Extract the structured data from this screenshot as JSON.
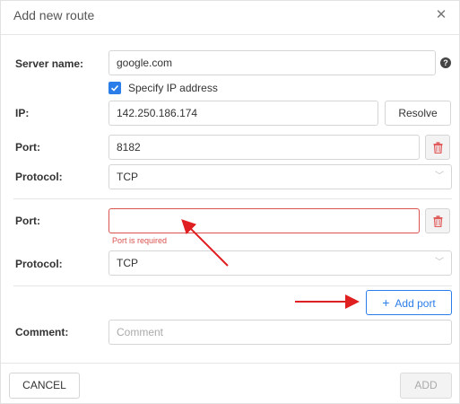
{
  "header": {
    "title": "Add new route",
    "close_glyph": "✕"
  },
  "form": {
    "server_name": {
      "label": "Server name:",
      "value": "google.com"
    },
    "specify_ip": {
      "label": "Specify IP address",
      "checked": true
    },
    "ip": {
      "label": "IP:",
      "value": "142.250.186.174",
      "resolve_label": "Resolve"
    },
    "ports": [
      {
        "port_label": "Port:",
        "port_value": "8182",
        "protocol_label": "Protocol:",
        "protocol_value": "TCP"
      },
      {
        "port_label": "Port:",
        "port_value": "",
        "error": "Port is required",
        "protocol_label": "Protocol:",
        "protocol_value": "TCP"
      }
    ],
    "add_port_label": "Add port",
    "comment": {
      "label": "Comment:",
      "placeholder": "Comment"
    }
  },
  "footer": {
    "cancel_label": "CANCEL",
    "add_label": "ADD"
  },
  "icons": {
    "help": "help-icon",
    "trash": "trash-icon",
    "check": "check-icon",
    "plus": "plus-icon",
    "chevron": "chevron-down-icon",
    "close": "close-icon"
  },
  "colors": {
    "accent": "#2b7de9",
    "error": "#d9534f",
    "annotation_arrow": "#e02020"
  }
}
